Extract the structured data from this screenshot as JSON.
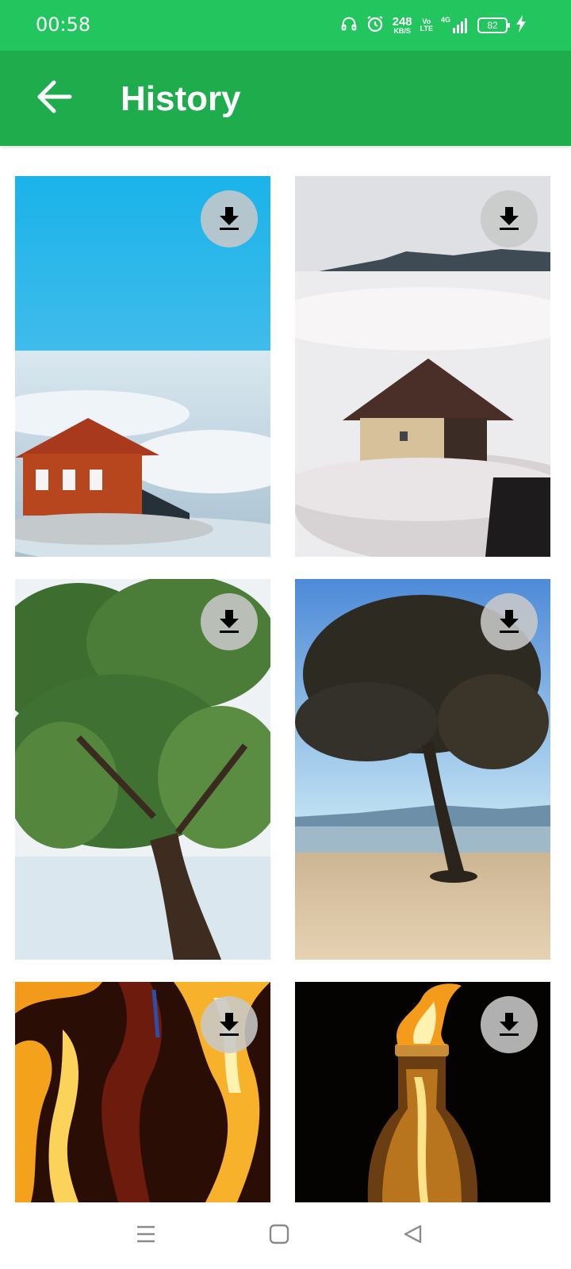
{
  "status_bar": {
    "time": "00:58",
    "net_speed_value": "248",
    "net_speed_unit": "KB/S",
    "volte_top": "Vo",
    "volte_bottom": "LTE",
    "network_type": "4G",
    "battery_level": "82",
    "icons": [
      "headphones-icon",
      "alarm-icon",
      "signal-icon",
      "battery-icon",
      "charging-icon"
    ]
  },
  "app_bar": {
    "title": "History",
    "back_icon": "arrow-left-icon",
    "background_color": "#1eac4c",
    "status_color": "#22c55e"
  },
  "history": {
    "items": [
      {
        "subject": "house-above-clouds-blue-sky",
        "action_icon": "download-icon"
      },
      {
        "subject": "house-in-fog-hills",
        "action_icon": "download-icon"
      },
      {
        "subject": "tree-over-sea",
        "action_icon": "download-icon"
      },
      {
        "subject": "tree-on-beach",
        "action_icon": "download-icon"
      },
      {
        "subject": "fire-bottle-closeup",
        "action_icon": "download-icon"
      },
      {
        "subject": "fire-bottle-dark",
        "action_icon": "download-icon"
      }
    ]
  },
  "nav_bar": {
    "buttons": [
      "menu-icon",
      "home-icon",
      "back-triangle-icon"
    ]
  }
}
